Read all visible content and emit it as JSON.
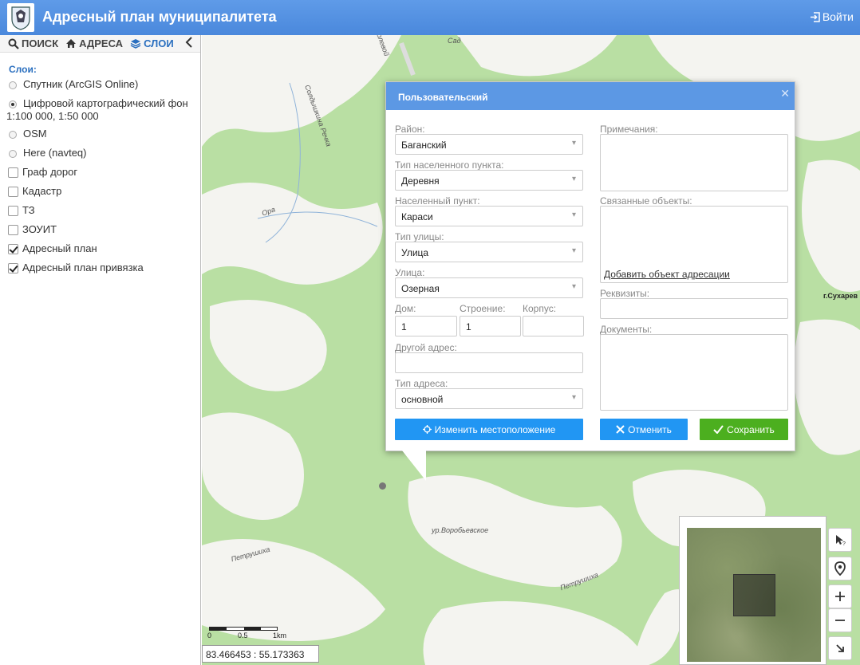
{
  "header": {
    "title": "Адресный план муниципалитета",
    "login_label": "Войти"
  },
  "sidebar": {
    "tabs": [
      {
        "label": "ПОИСК",
        "icon": "search-icon"
      },
      {
        "label": "АДРЕСА",
        "icon": "home-icon"
      },
      {
        "label": "СЛОИ",
        "icon": "layers-icon"
      }
    ],
    "layers_title": "Слои:",
    "layers": [
      {
        "label": "Спутник (ArcGIS Online)",
        "type": "radio",
        "checked": false
      },
      {
        "label": "Цифровой картографический фон",
        "sublabel": "1:100 000, 1:50 000",
        "type": "radio",
        "checked": true
      },
      {
        "label": "OSM",
        "type": "radio",
        "checked": false
      },
      {
        "label": "Here (navteq)",
        "type": "radio",
        "checked": false
      },
      {
        "label": "Граф дорог",
        "type": "checkbox",
        "checked": false
      },
      {
        "label": "Кадастр",
        "type": "checkbox",
        "checked": false
      },
      {
        "label": "ТЗ",
        "type": "checkbox",
        "checked": false
      },
      {
        "label": "ЗОУИТ",
        "type": "checkbox",
        "checked": false
      },
      {
        "label": "Адресный план",
        "type": "checkbox",
        "checked": true
      },
      {
        "label": "Адресный план привязка",
        "type": "checkbox",
        "checked": true
      }
    ]
  },
  "map": {
    "labels": [
      "Солдышкина Речка",
      "Ора",
      "Петрушиха",
      "Петрушиха",
      "ур.Воробьевское",
      "Сад",
      "Полевой"
    ],
    "city": "г.Сухарев",
    "scale": {
      "ticks": [
        "0",
        "0.5",
        "1km"
      ]
    },
    "coords": "83.466453 : 55.173363"
  },
  "dialog": {
    "title": "Пользовательский",
    "district_label": "Район:",
    "district_value": "Баганский",
    "settlement_type_label": "Тип населенного пункта:",
    "settlement_type_value": "Деревня",
    "settlement_label": "Населенный пункт:",
    "settlement_value": "Караси",
    "street_type_label": "Тип улицы:",
    "street_type_value": "Улица",
    "street_label": "Улица:",
    "street_value": "Озерная",
    "house_label": "Дом:",
    "house_value": "1",
    "building_label": "Строение:",
    "building_value": "1",
    "block_label": "Корпус:",
    "block_value": "",
    "other_address_label": "Другой адрес:",
    "other_address_value": "",
    "address_type_label": "Тип адреса:",
    "address_type_value": "основной",
    "notes_label": "Примечания:",
    "related_label": "Связанные объекты:",
    "add_object_link": "Добавить объект адресации",
    "requisites_label": "Реквизиты:",
    "documents_label": "Документы:",
    "change_location_button": "Изменить местоположение",
    "cancel_button": "Отменить",
    "save_button": "Сохранить"
  },
  "colors": {
    "header": "#4a88dc",
    "dialog_head": "#5c98e4",
    "button_blue": "#2196f3",
    "button_green": "#4caf1f",
    "map_green": "#b8e0a0"
  }
}
